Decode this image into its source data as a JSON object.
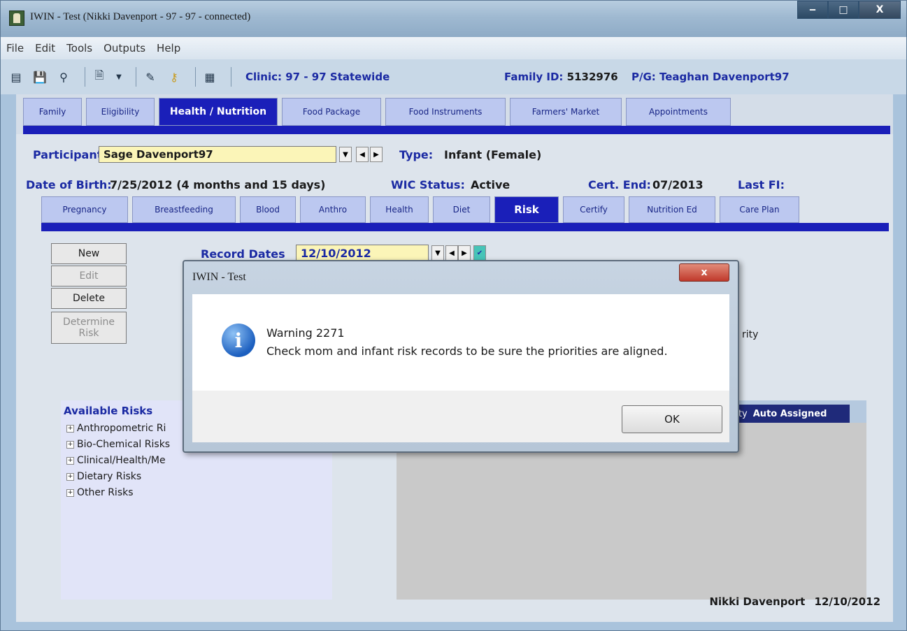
{
  "window": {
    "title": "IWIN - Test  (Nikki Davenport - 97 - 97 - connected)",
    "controls": [
      "‒",
      "□",
      "X"
    ]
  },
  "menu": [
    "File",
    "Edit",
    "Tools",
    "Outputs",
    "Help"
  ],
  "toolbar": {
    "clinic_label": "Clinic:",
    "clinic_value": "97 - 97 Statewide",
    "family_label": "Family ID:",
    "family_value": "5132976",
    "pg_label": "P/G:",
    "pg_value": "Teaghan Davenport97"
  },
  "main_tabs": [
    {
      "label": "Family"
    },
    {
      "label": "Eligibility"
    },
    {
      "label": "Health / Nutrition",
      "active": true
    },
    {
      "label": "Food Package"
    },
    {
      "label": "Food Instruments"
    },
    {
      "label": "Farmers' Market"
    },
    {
      "label": "Appointments"
    }
  ],
  "participant": {
    "label": "Participants",
    "value": "Sage Davenport97",
    "type_label": "Type:",
    "type_value": "Infant (Female)",
    "dob_label": "Date of Birth:",
    "dob_value": "7/25/2012 (4 months and 15 days)",
    "wic_label": "WIC Status:",
    "wic_value": "Active",
    "cert_label": "Cert. End:",
    "cert_value": "07/2013",
    "lastfi_label": "Last FI:"
  },
  "sub_tabs": [
    {
      "label": "Pregnancy"
    },
    {
      "label": "Breastfeeding"
    },
    {
      "label": "Blood"
    },
    {
      "label": "Anthro"
    },
    {
      "label": "Health"
    },
    {
      "label": "Diet"
    },
    {
      "label": "Risk",
      "active": true
    },
    {
      "label": "Certify"
    },
    {
      "label": "Nutrition Ed"
    },
    {
      "label": "Care Plan"
    }
  ],
  "actions": {
    "new": "New",
    "edit": "Edit",
    "delete": "Delete",
    "determine": "Determine Risk"
  },
  "record_dates": {
    "label": "Record Dates",
    "value": "12/10/2012"
  },
  "available_risks": {
    "title": "Available Risks",
    "items": [
      "Anthropometric Ri",
      "Bio-Chemical Risks",
      "Clinical/Health/Me",
      "Dietary Risks",
      "Other Risks"
    ]
  },
  "assigned": {
    "priority_fragment": "rity",
    "priority_col": "rity",
    "auto_col": "Auto Assigned"
  },
  "footer": {
    "user": "Nikki Davenport",
    "date": "12/10/2012"
  },
  "dialog": {
    "title": "IWIN - Test",
    "close": "x",
    "line1": "Warning 2271",
    "line2": "Check mom and infant risk records to be sure the priorities are aligned.",
    "ok": "OK"
  }
}
